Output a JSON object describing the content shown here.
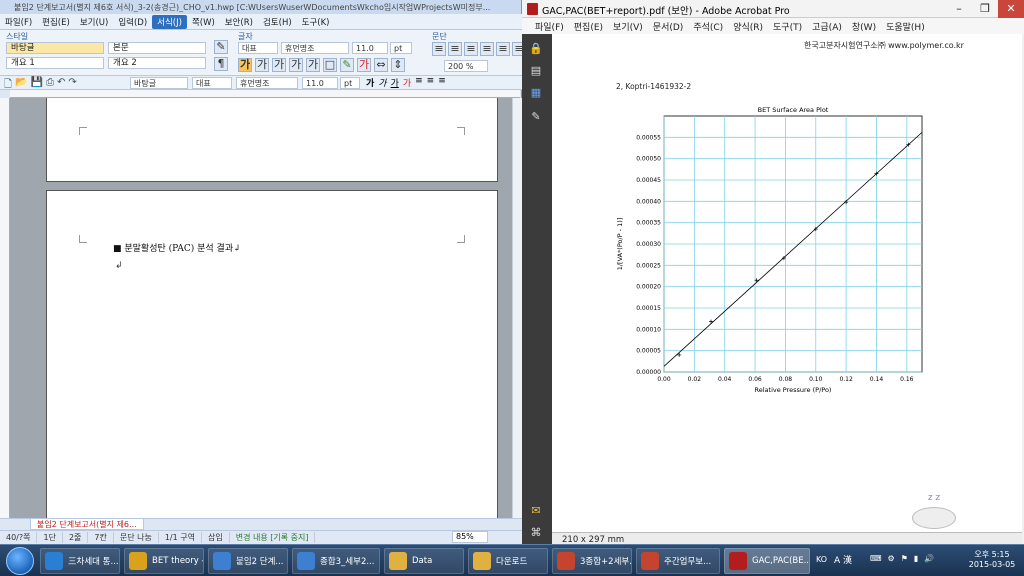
{
  "hwp": {
    "title": "붙임2 단계보고서(별지 제6호 서식)_3-2(송경근)_CHO_v1.hwp [C:WUsersWuserWDocumentsWkcho임시작업WProjectsW미정부...",
    "menus": [
      "파일(F)",
      "편집(E)",
      "보기(U)",
      "입력(D)",
      "서식(J)",
      "쪽(W)",
      "보안(R)",
      "검토(H)",
      "도구(K)"
    ],
    "active_menu": "서식(J)",
    "ribbon": {
      "style_label": "스타일",
      "styles": [
        "바탕글",
        "본문",
        "개요 1",
        "개요 2"
      ],
      "font_label": "글자",
      "font_lang": "대표",
      "font_name": "휴먼명조",
      "font_size": "11.0",
      "font_unit": "pt",
      "para_label": "문단",
      "zoom": "200 %"
    },
    "toolbar2": {
      "style": "바탕글",
      "lang": "대표",
      "font": "휴먼명조",
      "size": "11.0",
      "unit": "pt"
    },
    "document": {
      "heading": "■ 분말활성탄 (PAC) 분석 결과↲",
      "return_mark": "↲"
    },
    "doc_tab": "붙임2 단계보고서(별지 제6...",
    "status": [
      "40/?쪽",
      "1단",
      "2줄",
      "7칸",
      "문단 나눔",
      "1/1 구역",
      "삽입",
      "변경 내용 [기록 중지]"
    ],
    "zoom": "85%"
  },
  "acrobat": {
    "title": "GAC,PAC(BET+report).pdf (보안) - Adobe Acrobat Pro",
    "menus": [
      "파일(F)",
      "편집(E)",
      "보기(V)",
      "문서(D)",
      "주석(C)",
      "양식(R)",
      "도구(T)",
      "고급(A)",
      "창(W)",
      "도움말(H)"
    ],
    "page_size": "210 x 297 mm",
    "pdf": {
      "header": "한국고분자시험연구소㈜ www.polymer.co.kr",
      "sample": "2, Koptri-1461932-2"
    }
  },
  "chart_data": {
    "type": "line",
    "title": "BET Surface Area Plot",
    "xlabel": "Relative Pressure (P/Po)",
    "ylabel": "1/[VA*(Po/P - 1)]",
    "xlim": [
      0.0,
      0.17
    ],
    "ylim": [
      0.0,
      0.0006
    ],
    "x_ticks": [
      "0.00",
      "0.02",
      "0.04",
      "0.06",
      "0.08",
      "0.10",
      "0.12",
      "0.14",
      "0.16"
    ],
    "y_ticks": [
      "0.00000",
      "0.00005",
      "0.00010",
      "0.00015",
      "0.00020",
      "0.00025",
      "0.00030",
      "0.00035",
      "0.00040",
      "0.00045",
      "0.00050",
      "0.00055"
    ],
    "grid": true,
    "series": [
      {
        "points": [
          [
            0.01,
            4e-05
          ],
          [
            0.031,
            0.000118
          ],
          [
            0.061,
            0.000215
          ],
          [
            0.079,
            0.000267
          ],
          [
            0.1,
            0.000335
          ],
          [
            0.12,
            0.000398
          ],
          [
            0.14,
            0.000465
          ],
          [
            0.161,
            0.000533
          ]
        ]
      }
    ],
    "line_color": "#000000",
    "grid_color": "#7fd3e6"
  },
  "taskbar": {
    "items": [
      {
        "label": "三차세대 통...",
        "color": "#2a7fd4",
        "icon": "ie-icon"
      },
      {
        "label": "BET theory -...",
        "color": "#d9a21a",
        "icon": "chrome-icon"
      },
      {
        "label": "붙임2 단계...",
        "color": "#3d7fd1",
        "icon": "hwp-icon"
      },
      {
        "label": "종합3_세부2...",
        "color": "#3d7fd1",
        "icon": "hwp-icon"
      },
      {
        "label": "Data",
        "color": "#e0b040",
        "icon": "folder-icon"
      },
      {
        "label": "다운로드",
        "color": "#e0b040",
        "icon": "folder-icon"
      },
      {
        "label": "3종합+2세부...",
        "color": "#c4442f",
        "icon": "ppt-icon"
      },
      {
        "label": "주간업무보...",
        "color": "#c4442f",
        "icon": "ppt-icon"
      },
      {
        "label": "GAC,PAC(BE...",
        "color": "#b21d1d",
        "icon": "pdf-icon"
      }
    ],
    "lang": "KO",
    "ime": "A 漢",
    "time": "오후 5:15",
    "date": "2015-03-05"
  }
}
